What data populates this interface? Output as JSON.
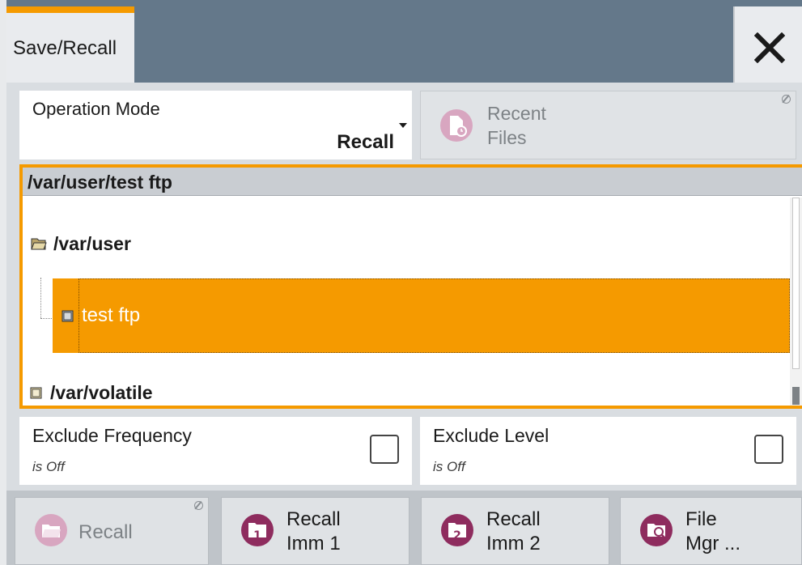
{
  "dialog": {
    "title": "Save/Recall",
    "close_icon": "close-icon"
  },
  "operation_mode": {
    "label": "Operation Mode",
    "value": "Recall"
  },
  "recent_files": {
    "line1": "Recent",
    "line2": "Files"
  },
  "tree": {
    "current_path": "/var/user/test ftp",
    "nodes": [
      {
        "label": "/var/user",
        "selected": false
      },
      {
        "label": "test ftp",
        "selected": true
      },
      {
        "label": "/var/volatile",
        "selected": false
      }
    ]
  },
  "exclude_frequency": {
    "label": "Exclude Frequency",
    "state": "is Off"
  },
  "exclude_level": {
    "label": "Exclude Level",
    "state": "is Off"
  },
  "toolbar": {
    "recall": {
      "label": "Recall"
    },
    "recall_imm1": {
      "line1": "Recall",
      "line2": "Imm 1"
    },
    "recall_imm2": {
      "line1": "Recall",
      "line2": "Imm 2"
    },
    "file_mgr": {
      "line1": "File",
      "line2": "Mgr ..."
    }
  },
  "colors": {
    "accent": "#f59a00",
    "titlebar": "#64788a",
    "icon_magenta": "#8e2c5e"
  }
}
